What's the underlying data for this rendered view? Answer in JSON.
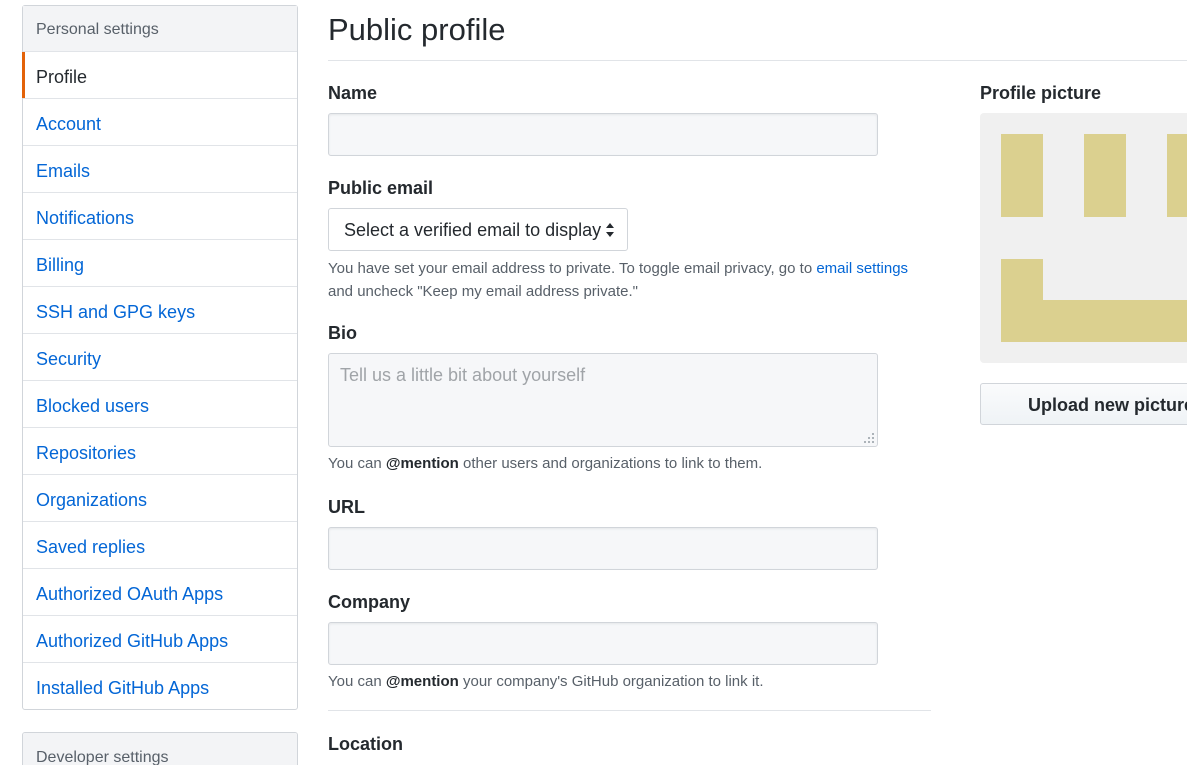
{
  "sidebar": {
    "header": "Personal settings",
    "items": [
      {
        "label": "Profile"
      },
      {
        "label": "Account"
      },
      {
        "label": "Emails"
      },
      {
        "label": "Notifications"
      },
      {
        "label": "Billing"
      },
      {
        "label": "SSH and GPG keys"
      },
      {
        "label": "Security"
      },
      {
        "label": "Blocked users"
      },
      {
        "label": "Repositories"
      },
      {
        "label": "Organizations"
      },
      {
        "label": "Saved replies"
      },
      {
        "label": "Authorized OAuth Apps"
      },
      {
        "label": "Authorized GitHub Apps"
      },
      {
        "label": "Installed GitHub Apps"
      }
    ],
    "selected": "Profile",
    "developer_header": "Developer settings"
  },
  "main": {
    "title": "Public profile",
    "name": {
      "label": "Name",
      "value": ""
    },
    "public_email": {
      "label": "Public email",
      "selected": "Select a verified email to display",
      "note_prefix": "You have set your email address to private. To toggle email privacy, go to ",
      "note_link": "email settings",
      "note_suffix": "and uncheck \"Keep my email address private.\""
    },
    "bio": {
      "label": "Bio",
      "placeholder": "Tell us a little bit about yourself",
      "note_prefix": "You can ",
      "note_bold": "@mention",
      "note_suffix": " other users and organizations to link to them."
    },
    "url": {
      "label": "URL",
      "value": ""
    },
    "company": {
      "label": "Company",
      "value": "",
      "note_prefix": "You can ",
      "note_bold": "@mention",
      "note_suffix": " your company's GitHub organization to link it."
    },
    "location": {
      "label": "Location"
    }
  },
  "profile_picture": {
    "label": "Profile picture",
    "upload_label": "Upload new picture",
    "identicon_color": "#dbd08f"
  },
  "colors": {
    "link": "#0366d6",
    "selected_accent": "#e36209"
  }
}
